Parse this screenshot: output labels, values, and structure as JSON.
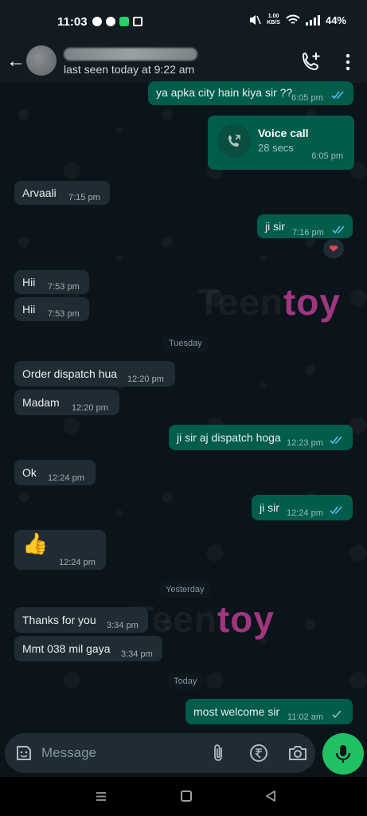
{
  "status_bar": {
    "time": "11:03",
    "network_speed_value": "1.00",
    "network_speed_unit": "KB/S",
    "battery": "44%"
  },
  "header": {
    "last_seen": "last seen today at 9:22 am",
    "icons": [
      "back-arrow-icon",
      "add-call-icon",
      "more-vert-icon"
    ]
  },
  "messages": [
    {
      "dir": "out",
      "text": "ya apka city hain kiya sir ??",
      "time": "6:05 pm",
      "status": "read"
    },
    {
      "dir": "out",
      "type": "voice_call",
      "title": "Voice call",
      "duration": "28 secs",
      "time": "6:05 pm"
    },
    {
      "dir": "in",
      "text": "Arvaali",
      "time": "7:15 pm"
    },
    {
      "dir": "out",
      "text": "ji sir",
      "time": "7:16 pm",
      "status": "read",
      "reaction": "heart"
    },
    {
      "dir": "in",
      "text": "Hii",
      "time": "7:53 pm"
    },
    {
      "dir": "in",
      "text": "Hii",
      "time": "7:53 pm"
    },
    {
      "dir": "in",
      "text": "Order dispatch hua",
      "time": "12:20 pm"
    },
    {
      "dir": "in",
      "text": "Madam",
      "time": "12:20 pm"
    },
    {
      "dir": "out",
      "text": "ji sir aj dispatch hoga",
      "time": "12:23 pm",
      "status": "read"
    },
    {
      "dir": "in",
      "text": "Ok",
      "time": "12:24 pm"
    },
    {
      "dir": "out",
      "text": "ji sir",
      "time": "12:24 pm",
      "status": "read"
    },
    {
      "dir": "in",
      "text": "👍",
      "time": "12:24 pm"
    },
    {
      "dir": "in",
      "text": "Thanks for you",
      "time": "3:34 pm"
    },
    {
      "dir": "in",
      "text": "Mmt 038 mil gaya",
      "time": "3:34 pm"
    },
    {
      "dir": "out",
      "text": "most welcome sir",
      "time": "11:02 am",
      "status": "sent"
    }
  ],
  "day_separators": [
    "Tuesday",
    "Yesterday",
    "Today"
  ],
  "watermark": {
    "prefix": "Teen",
    "brand": "toy",
    "color": "#b03a8c"
  },
  "composer": {
    "placeholder": "Message",
    "icons": [
      "sticker-icon",
      "attach-icon",
      "rupee-icon",
      "camera-icon",
      "mic-icon"
    ]
  },
  "colors": {
    "background": "#0b141a",
    "incoming_bubble": "#202c33",
    "outgoing_bubble": "#005c4b",
    "read_tick": "#53bdeb",
    "accent": "#21c063"
  }
}
